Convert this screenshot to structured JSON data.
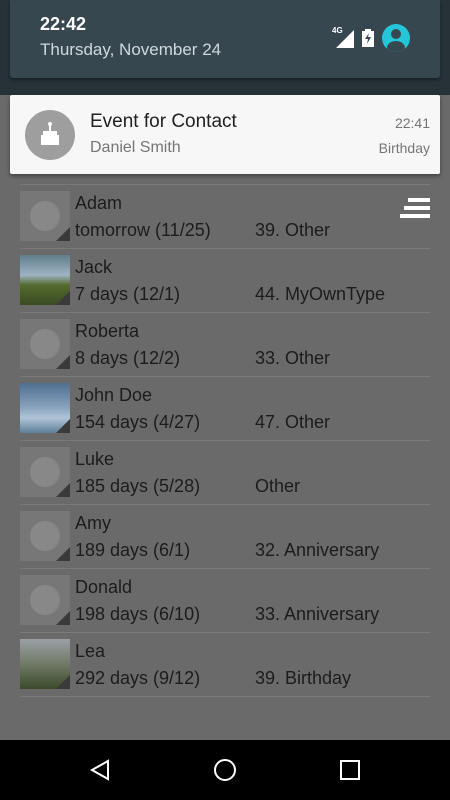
{
  "status": {
    "time": "22:42",
    "date": "Thursday, November 24",
    "network": "4G"
  },
  "notification": {
    "title": "Event for Contact",
    "contact": "Daniel Smith",
    "time": "22:41",
    "type": "Birthday"
  },
  "contacts": [
    {
      "name": "Adam",
      "when": "tomorrow (11/25)",
      "event": "39. Other"
    },
    {
      "name": "Jack",
      "when": "7 days (12/1)",
      "event": "44. MyOwnType"
    },
    {
      "name": "Roberta",
      "when": "8 days (12/2)",
      "event": "33. Other"
    },
    {
      "name": "John Doe",
      "when": "154 days (4/27)",
      "event": "47. Other"
    },
    {
      "name": "Luke",
      "when": "185 days (5/28)",
      "event": "Other"
    },
    {
      "name": "Amy",
      "when": "189 days (6/1)",
      "event": "32. Anniversary"
    },
    {
      "name": "Donald",
      "when": "198 days (6/10)",
      "event": "33. Anniversary"
    },
    {
      "name": "Lea",
      "when": "292 days (9/12)",
      "event": "39. Birthday"
    }
  ],
  "colors": {
    "accent": "#26c6da",
    "shade": "#263238",
    "overlay": "#6a6a6a"
  }
}
